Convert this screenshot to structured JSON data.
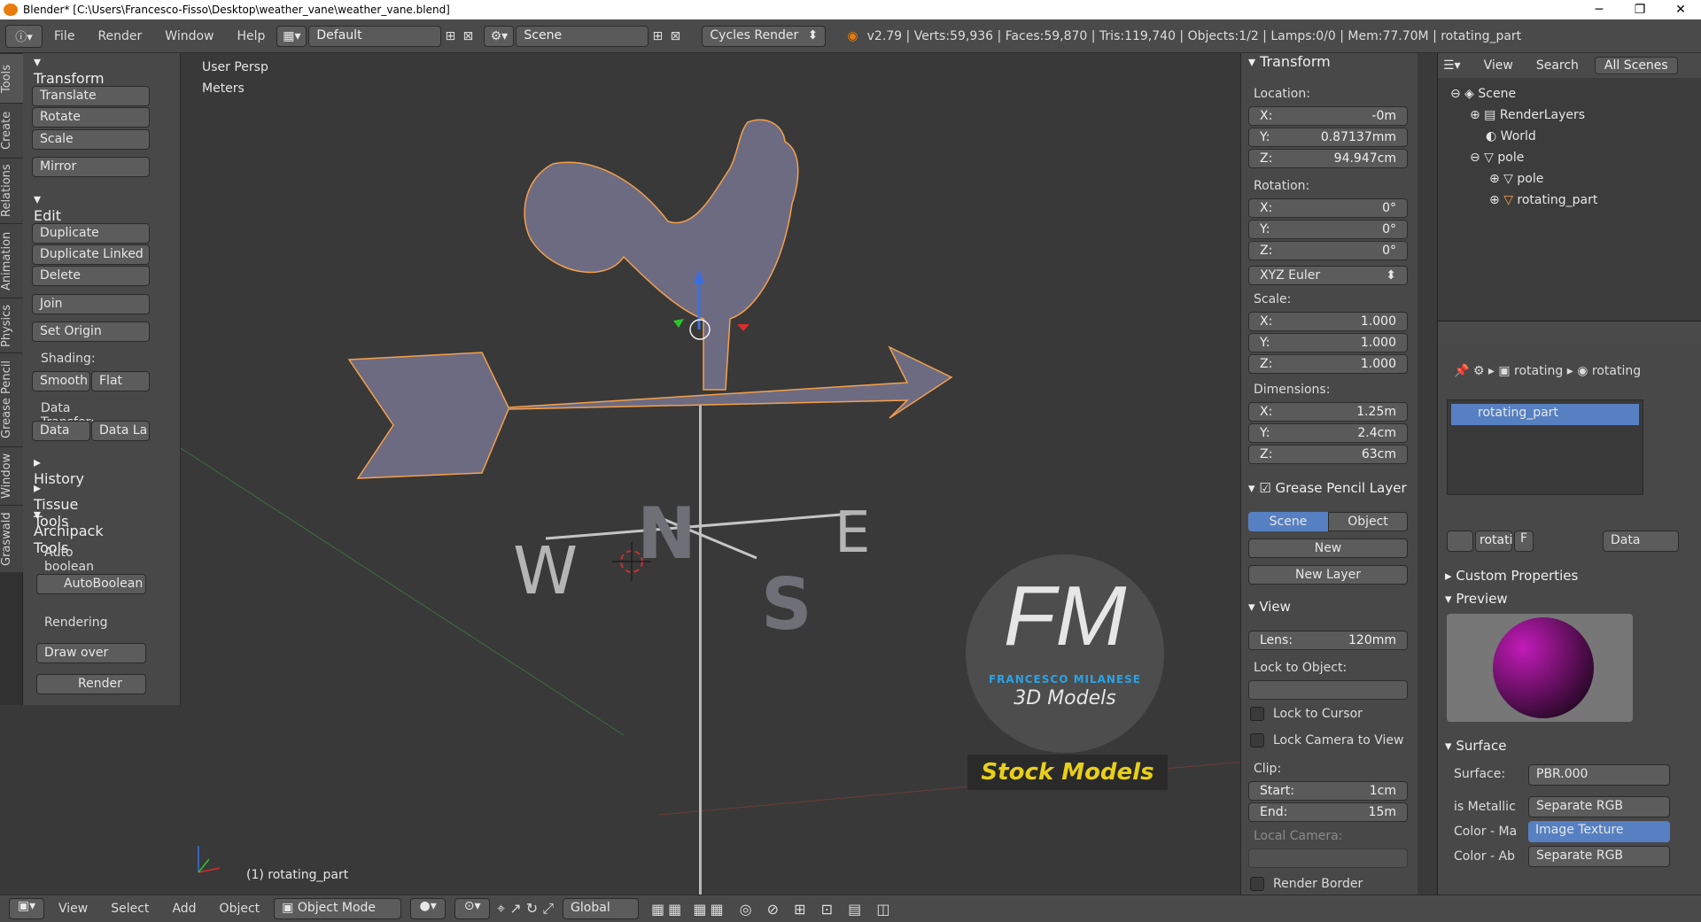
{
  "window": {
    "title": "Blender* [C:\\Users\\Francesco-Fisso\\Desktop\\weather_vane\\weather_vane.blend]"
  },
  "infobar": {
    "menus": [
      "File",
      "Render",
      "Window",
      "Help"
    ],
    "layout": "Default",
    "scene": "Scene",
    "engine": "Cycles Render",
    "stats": "v2.79 | Verts:59,936 | Faces:59,870 | Tris:119,740 | Objects:1/2 | Lamps:0/0 | Mem:77.70M | rotating_part"
  },
  "tabs": [
    "Tools",
    "Create",
    "Relations",
    "Animation",
    "Physics",
    "Grease Pencil",
    "Window",
    "Graswald"
  ],
  "tools": {
    "transform_title": "Transform",
    "translate": "Translate",
    "rotate": "Rotate",
    "scale": "Scale",
    "mirror": "Mirror",
    "edit_title": "Edit",
    "duplicate": "Duplicate",
    "duplicate_linked": "Duplicate Linked",
    "delete": "Delete",
    "join": "Join",
    "set_origin": "Set Origin",
    "shading_label": "Shading:",
    "smooth": "Smooth",
    "flat": "Flat",
    "data_transfer_label": "Data Transfer:",
    "data": "Data",
    "data_la": "Data La",
    "history": "History",
    "tissue": "Tissue Tools",
    "archipack": "Archipack Tools",
    "auto_boolean_label": "Auto boolean",
    "auto_boolean_btn": "AutoBoolean",
    "rendering_label": "Rendering",
    "draw_over": "Draw over",
    "render": "Render"
  },
  "viewport": {
    "view_name": "User Persp",
    "units": "Meters",
    "object_label": "(1) rotating_part",
    "watermark": {
      "letters": "FM",
      "name": "FRANCESCO MILANESE",
      "sub": "3D Models",
      "stock": "Stock Models"
    },
    "compass": [
      "N",
      "E",
      "S",
      "W"
    ]
  },
  "npanel": {
    "transform_title": "Transform",
    "location_label": "Location:",
    "location": {
      "x": "X:",
      "xv": "-0m",
      "y": "Y:",
      "yv": "0.87137mm",
      "z": "Z:",
      "zv": "94.947cm"
    },
    "rotation_label": "Rotation:",
    "rotation": {
      "x": "X:",
      "xv": "0°",
      "y": "Y:",
      "yv": "0°",
      "z": "Z:",
      "zv": "0°"
    },
    "rotation_mode": "XYZ Euler",
    "scale_label": "Scale:",
    "scale": {
      "x": "X:",
      "xv": "1.000",
      "y": "Y:",
      "yv": "1.000",
      "z": "Z:",
      "zv": "1.000"
    },
    "dimensions_label": "Dimensions:",
    "dimensions": {
      "x": "X:",
      "xv": "1.25m",
      "y": "Y:",
      "yv": "2.4cm",
      "z": "Z:",
      "zv": "63cm"
    },
    "gp_title": "Grease Pencil Layer",
    "gp_scene": "Scene",
    "gp_object": "Object",
    "gp_new": "New",
    "gp_new_layer": "New Layer",
    "view_title": "View",
    "lens": "Lens:",
    "lens_val": "120mm",
    "lock_to_object": "Lock to Object:",
    "lock_to_cursor": "Lock to Cursor",
    "lock_camera": "Lock Camera to View",
    "clip_label": "Clip:",
    "clip_start": "Start:",
    "clip_start_val": "1cm",
    "clip_end": "End:",
    "clip_end_val": "15m",
    "local_camera": "Local Camera:",
    "render_border": "Render Border"
  },
  "outliner": {
    "view": "View",
    "search": "Search",
    "filter": "All Scenes",
    "items": [
      "Scene",
      "RenderLayers",
      "World",
      "pole",
      "pole",
      "rotating_part"
    ]
  },
  "properties": {
    "breadcrumb_1": "rotating",
    "breadcrumb_2": "rotating",
    "material_slot": "rotating_part",
    "mat_name": "rotati",
    "mat_f": "F",
    "mat_link": "Data",
    "custom_props": "Custom Properties",
    "preview": "Preview",
    "surface_title": "Surface",
    "surface_label": "Surface:",
    "surface_value": "PBR.000",
    "rows": [
      {
        "label": "is Metallic",
        "value": "Separate RGB"
      },
      {
        "label": "Color - Ma",
        "value": "Image Texture"
      },
      {
        "label": "Color - Ab",
        "value": "Separate RGB"
      }
    ]
  },
  "bottombar": {
    "view": "View",
    "select": "Select",
    "add": "Add",
    "object": "Object",
    "mode": "Object Mode",
    "orientation": "Global"
  },
  "colors": {
    "accent": "#5680c2",
    "selection_outline": "#f5a04b",
    "mesh": "#6d6b82"
  }
}
